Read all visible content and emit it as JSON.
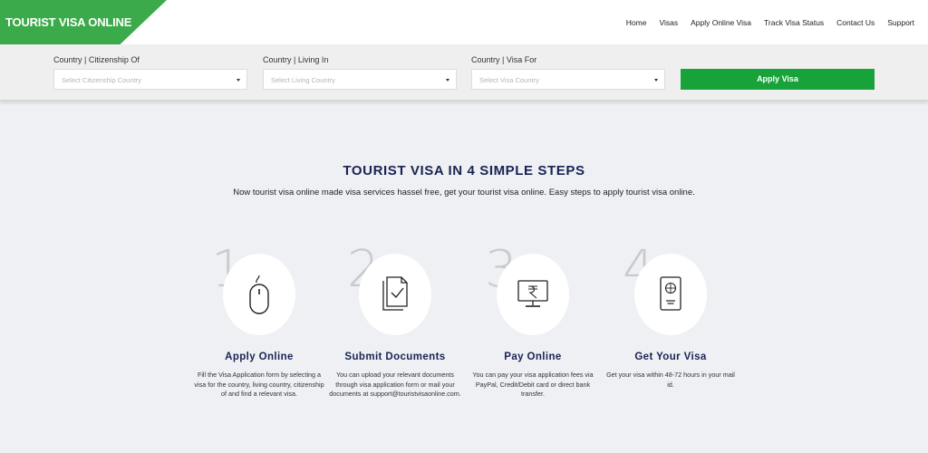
{
  "header": {
    "logo": "TOURIST VISA ONLINE",
    "nav": [
      "Home",
      "Visas",
      "Apply Online Visa",
      "Track Visa Status",
      "Contact Us",
      "Support"
    ]
  },
  "search": {
    "fields": [
      {
        "label": "Country | Citizenship Of",
        "placeholder": "Select Citizenship Country"
      },
      {
        "label": "Country | Living In",
        "placeholder": "Select Living Country"
      },
      {
        "label": "Country | Visa For",
        "placeholder": "Select Visa Country"
      }
    ],
    "button": "Apply Visa"
  },
  "section": {
    "title": "TOURIST VISA IN 4 SIMPLE STEPS",
    "subtitle": "Now tourist visa online made visa services hassel free, get your tourist visa online. Easy steps to apply tourist visa online."
  },
  "steps": [
    {
      "num": "1",
      "title": "Apply Online",
      "desc": "Fill the Visa Application form by selecting a visa for the country, living country, citizenship of and find a relevant visa.",
      "icon": "mouse-icon"
    },
    {
      "num": "2",
      "title": "Submit Documents",
      "desc": "You can upload your relevant documents through visa application form or mail your documents at support@touristvisaonline.com.",
      "icon": "documents-icon"
    },
    {
      "num": "3",
      "title": "Pay Online",
      "desc": "You can pay your visa application fees via PayPal, Credit/Debit card or direct bank transfer.",
      "icon": "monitor-rupee-icon"
    },
    {
      "num": "4",
      "title": "Get Your Visa",
      "desc": "Get your visa within 48-72 hours in your mail id.",
      "icon": "passport-icon"
    }
  ],
  "colors": {
    "brand": "#3aaa4a",
    "button": "#18a23a",
    "heading": "#1a2352"
  }
}
